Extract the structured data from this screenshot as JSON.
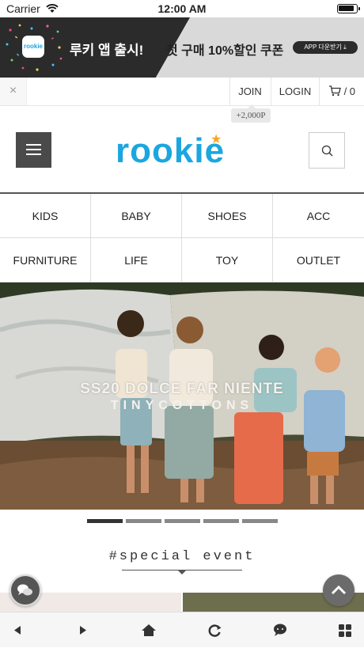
{
  "status_bar": {
    "carrier": "Carrier",
    "time": "12:00 AM"
  },
  "banner": {
    "app_icon_text": "rookie",
    "headline": "루키 앱 출시!",
    "promo": "첫 구매 10%할인 쿠폰",
    "download_label": "APP 다운받기 ⤓"
  },
  "top_nav": {
    "close_glyph": "×",
    "join": "JOIN",
    "login": "LOGIN",
    "cart_count": "/ 0",
    "join_reward": "+2,000P"
  },
  "header": {
    "logo_text": "rookie"
  },
  "categories": [
    "KIDS",
    "BABY",
    "SHOES",
    "ACC",
    "FURNITURE",
    "LIFE",
    "TOY",
    "OUTLET"
  ],
  "hero": {
    "title": "SS20 DOLCE FAR NIENTE",
    "subtitle": "TINYCOTTONS",
    "slide_count": 5,
    "active_slide": 1
  },
  "section": {
    "special_event": "#special event"
  },
  "icons": {
    "wifi": "wifi-icon",
    "battery": "battery-icon",
    "menu": "hamburger-icon",
    "search": "search-icon",
    "cart": "cart-icon",
    "chat": "chat-icon",
    "top": "chevron-up-icon",
    "back": "back-icon",
    "forward": "forward-icon",
    "home": "home-icon",
    "reload": "reload-icon",
    "comment": "comment-icon",
    "apps": "grid-icon"
  },
  "colors": {
    "brand": "#1ba6e0",
    "star": "#f5a623",
    "dark": "#2b2b2b"
  }
}
